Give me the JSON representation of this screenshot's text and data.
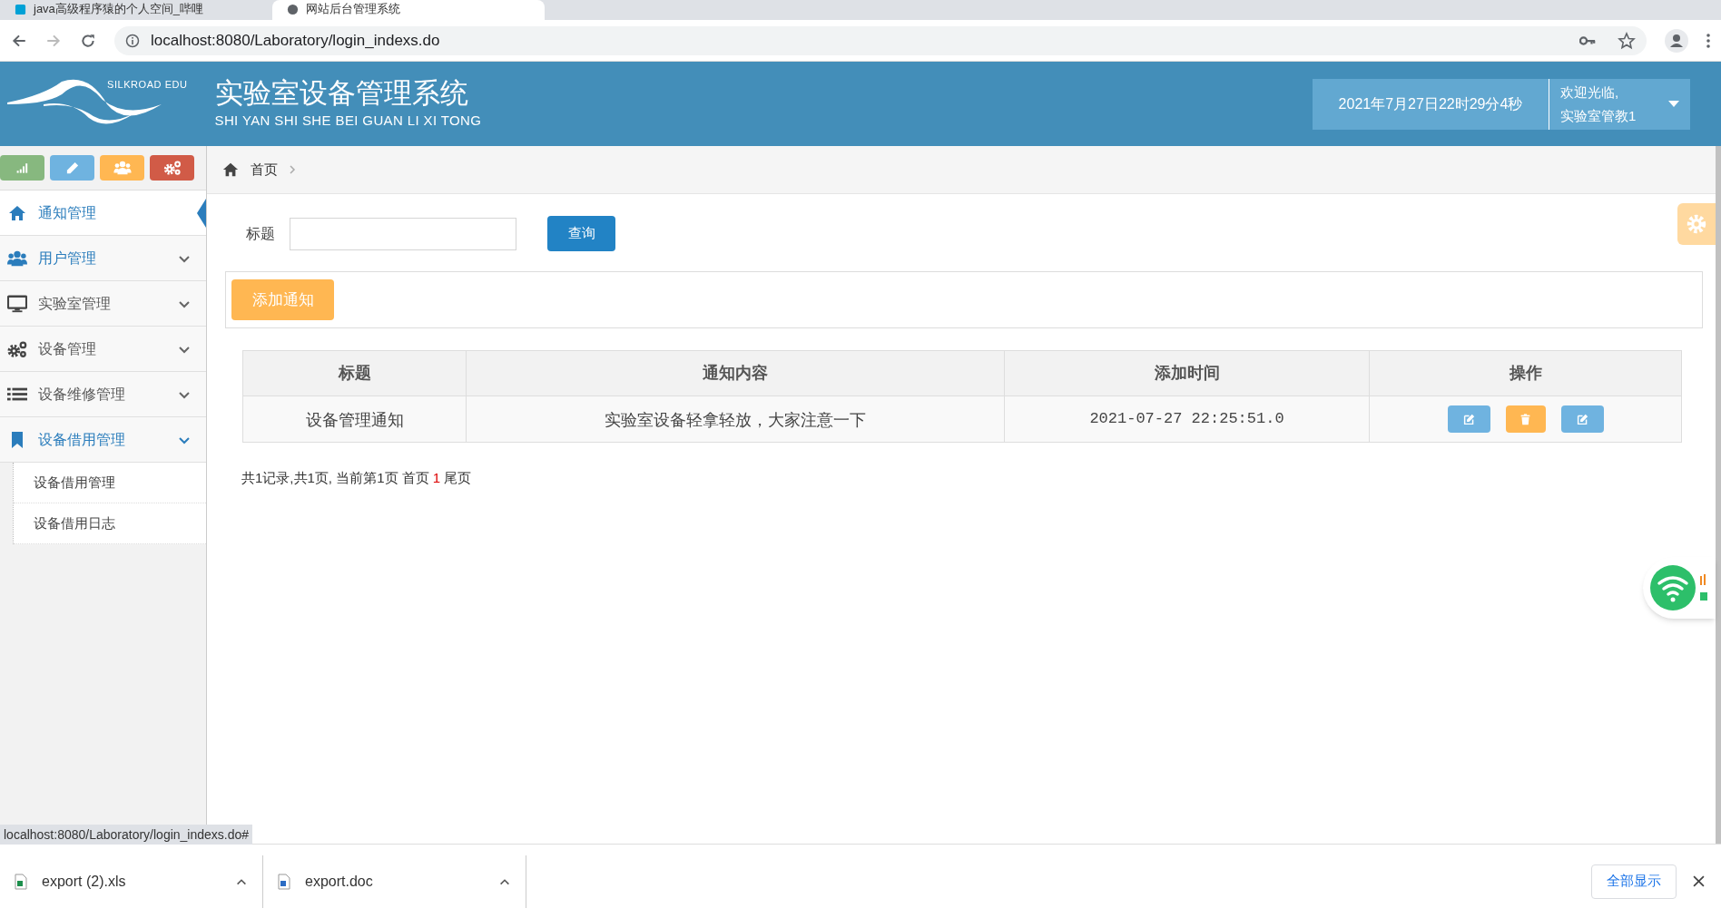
{
  "browser": {
    "tabs": [
      {
        "title": "java高级程序猿的个人空间_哔哩",
        "selected": false
      },
      {
        "title": "网站后台管理系统",
        "selected": true
      }
    ],
    "url": "localhost:8080/Laboratory/login_indexs.do"
  },
  "header": {
    "logo_text": "SILKROAD EDU",
    "title": "实验室设备管理系统",
    "subtitle": "SHI YAN SHI SHE BEI GUAN LI XI TONG",
    "datetime": "2021年7月27日22时29分4秒",
    "welcome": "欢迎光临,",
    "user": "实验室管教1"
  },
  "shortcuts": [
    {
      "kind": "chart",
      "color": "#87b87f"
    },
    {
      "kind": "pencil",
      "color": "#6fb3e0"
    },
    {
      "kind": "users",
      "color": "#ffb752"
    },
    {
      "kind": "gears",
      "color": "#d15b47"
    }
  ],
  "sidebar": {
    "items": [
      {
        "label": "通知管理",
        "selected": true,
        "highlighted": true,
        "expanded": false
      },
      {
        "label": "用户管理",
        "selected": false,
        "highlighted": true,
        "expanded": false
      },
      {
        "label": "实验室管理",
        "selected": false,
        "highlighted": false,
        "expanded": false
      },
      {
        "label": "设备管理",
        "selected": false,
        "highlighted": false,
        "expanded": false
      },
      {
        "label": "设备维修管理",
        "selected": false,
        "highlighted": false,
        "expanded": false
      },
      {
        "label": "设备借用管理",
        "selected": false,
        "highlighted": true,
        "expanded": true,
        "children": [
          {
            "label": "设备借用管理"
          },
          {
            "label": "设备借用日志"
          }
        ]
      }
    ]
  },
  "breadcrumb": [
    "首页"
  ],
  "search": {
    "label": "标题",
    "button": "查询"
  },
  "add_button": "添加通知",
  "table": {
    "columns": [
      "标题",
      "通知内容",
      "添加时间",
      "操作"
    ],
    "rows": [
      {
        "cells": [
          "设备管理通知",
          "实验室设备轻拿轻放，大家注意一下",
          "2021-07-27 22:25:51.0"
        ],
        "actions": [
          {
            "kind": "edit"
          },
          {
            "kind": "delete"
          },
          {
            "kind": "edit"
          }
        ]
      }
    ]
  },
  "pagination": {
    "summary": "共1记录,共1页, 当前第1页 首页",
    "current": "1",
    "last": "尾页"
  },
  "status_url": "localhost:8080/Laboratory/login_indexs.do#",
  "downloads": {
    "files": [
      {
        "name": "export (2).xls",
        "kind": "xls"
      },
      {
        "name": "export.doc",
        "kind": "doc"
      }
    ],
    "show_all": "全部显示"
  }
}
